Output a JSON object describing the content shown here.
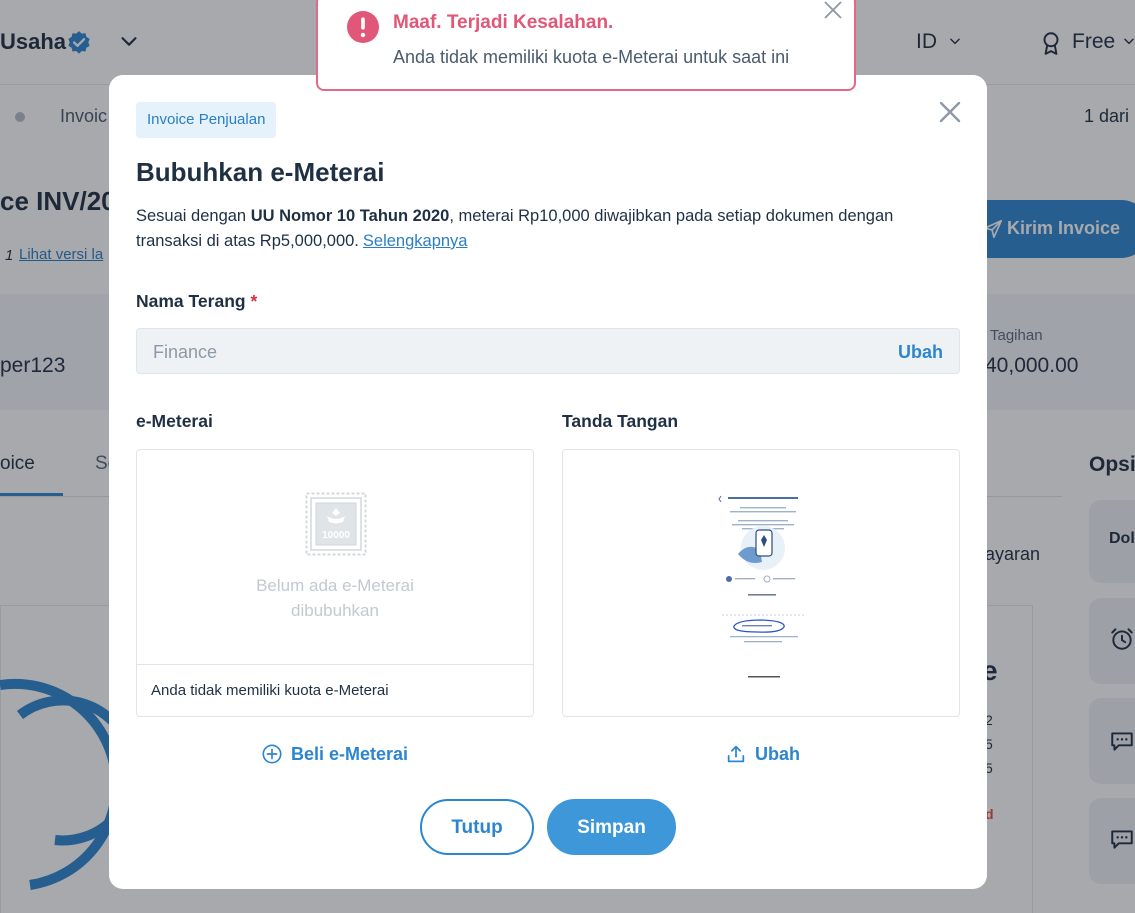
{
  "background": {
    "header": {
      "business_name": "Usaha",
      "language": "ID",
      "plan": "Free"
    },
    "breadcrumb": {
      "item": "Invoic",
      "pager": "1 dari"
    },
    "invoice_title": "ce INV/20",
    "version_number": "1",
    "version_link": "Lihat versi la",
    "send_button": "Kirim Invoice",
    "summary": {
      "left_value": "per123",
      "label": "Tagihan",
      "value": "40,000.00"
    },
    "tabs": {
      "active": "oice",
      "second": "Se"
    },
    "side_title": "Opsi",
    "payment_text": "ayaran",
    "side_card_text": "Dol",
    "preview": {
      "big_letter": "e",
      "lines": [
        "2",
        "5",
        "5"
      ],
      "red_text": "d"
    }
  },
  "modal": {
    "chip": "Invoice Penjualan",
    "title": "Bubuhkan e-Meterai",
    "description_prefix": "Sesuai dengan ",
    "description_bold": "UU Nomor 10 Tahun 2020",
    "description_suffix": ", meterai Rp10,000 diwajibkan pada setiap dokumen dengan transaksi di atas Rp5,000,000.",
    "description_link": "Selengkapnya",
    "name_label": "Nama Terang",
    "required_mark": "*",
    "name_value": "Finance",
    "name_action": "Ubah",
    "emeterai_label": "e-Meterai",
    "emeterai_placeholder_line1": "Belum ada e-Meterai",
    "emeterai_placeholder_line2": "dibubuhkan",
    "emeterai_stamp_value": "10000",
    "emeterai_footer": "Anda tidak memiliki kuota e-Meterai",
    "signature_label": "Tanda Tangan",
    "buy_action": "Beli e-Meterai",
    "change_action": "Ubah",
    "close_button": "Tutup",
    "save_button": "Simpan"
  },
  "toast": {
    "title": "Maaf. Terjadi Kesalahan.",
    "message": "Anda tidak memiliki kuota e-Meterai untuk saat ini"
  },
  "colors": {
    "primary": "#2c86cf",
    "error": "#e05777",
    "text": "#1f3044",
    "muted": "#8d99a6"
  }
}
